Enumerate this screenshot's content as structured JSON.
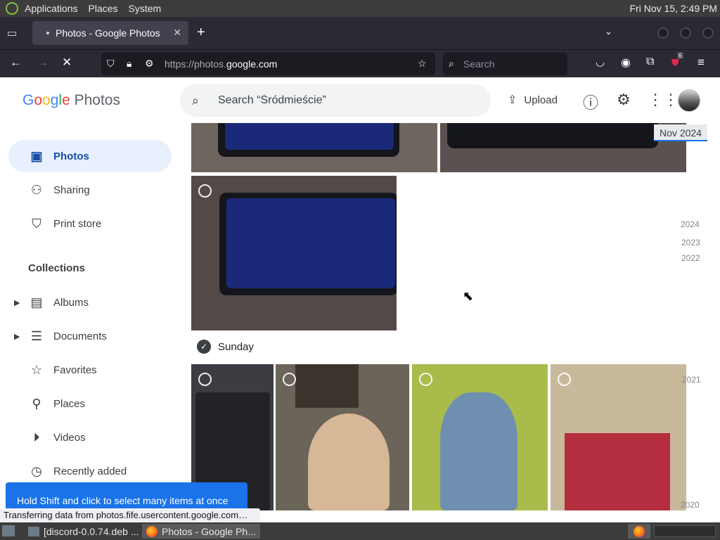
{
  "top_panel": {
    "menus": [
      "Applications",
      "Places",
      "System"
    ],
    "clock": "Fri Nov 15,  2:49 PM"
  },
  "browser": {
    "tab_title": "Photos - Google Photos",
    "url_prefix": "https://photos.",
    "url_domain": "google.com",
    "search_placeholder": "Search",
    "extension_badge": "6"
  },
  "photos_app": {
    "logo_word": "Photos",
    "search_placeholder": "Search “Śródmieście”",
    "upload_label": "Upload",
    "nav": [
      {
        "label": "Photos",
        "icon": "photo-icon"
      },
      {
        "label": "Sharing",
        "icon": "people-icon"
      },
      {
        "label": "Print store",
        "icon": "bag-icon"
      }
    ],
    "collections_title": "Collections",
    "collections": [
      {
        "label": "Albums",
        "icon": "album-icon"
      },
      {
        "label": "Documents",
        "icon": "document-icon"
      },
      {
        "label": "Favorites",
        "icon": "star-icon"
      },
      {
        "label": "Places",
        "icon": "location-icon"
      },
      {
        "label": "Videos",
        "icon": "play-icon"
      },
      {
        "label": "Recently added",
        "icon": "clock-icon"
      }
    ],
    "date_header": "Sunday",
    "timeline": {
      "current": "Nov 2024",
      "years": [
        "2024",
        "2023",
        "2022",
        "2021",
        "2020"
      ]
    },
    "snackbar": "Hold Shift and click to select many items at once"
  },
  "status_text": "Transferring data from photos.fife.usercontent.google.com…",
  "taskbar": {
    "items": [
      "[discord-0.0.74.deb ...",
      "Photos - Google Ph..."
    ]
  }
}
